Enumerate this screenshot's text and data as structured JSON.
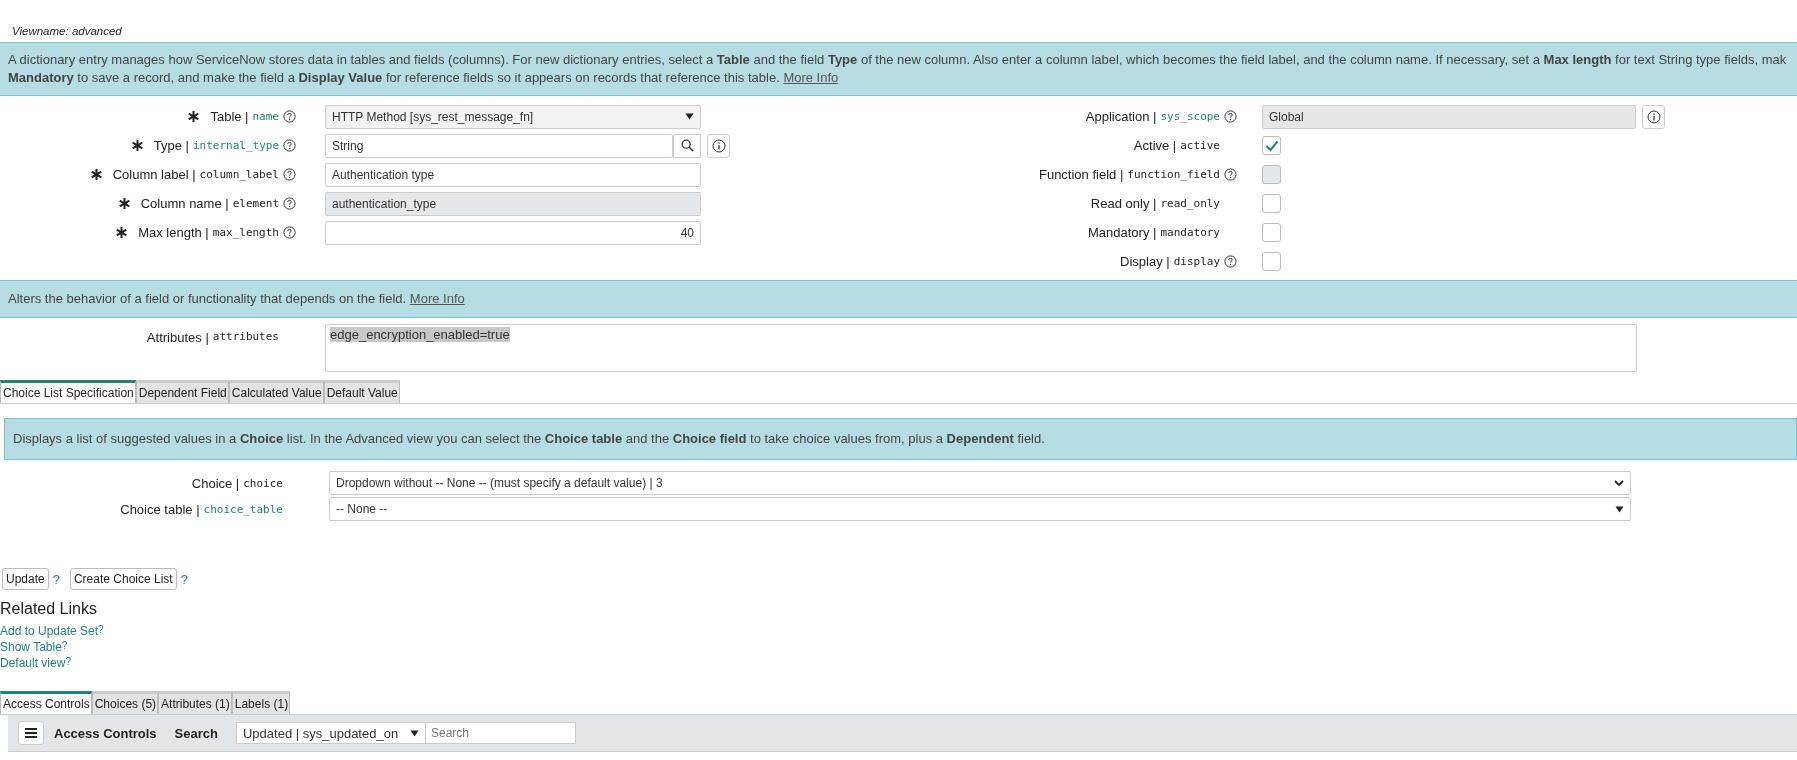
{
  "viewname": "Viewname: advanced",
  "info_banner": {
    "lines": [
      "A dictionary entry manages how ServiceNow stores data in tables and fields (columns). For new dictionary entries, select a **Table** and the field **Type** of the new column. Also enter a column label, which becomes the field label, and the column name. If necessary, set a **Max length** for text String type fields, mak",
      "**Mandatory** to save a record, and make the field a **Display Value** for reference fields so it appears on records that reference this table."
    ],
    "link": "More Info"
  },
  "left_fields": [
    {
      "label": "Table |",
      "name": "name",
      "required": true,
      "reference": true,
      "help": true,
      "kind": "select",
      "value": "HTTP Method [sys_rest_message_fn]"
    },
    {
      "label": "Type |",
      "name": "internal_type",
      "required": true,
      "reference": true,
      "help": true,
      "kind": "lookup",
      "value": "String"
    },
    {
      "label": "Column label |",
      "name": "column_label",
      "required": true,
      "reference": false,
      "help": true,
      "kind": "text",
      "value": "Authentication type"
    },
    {
      "label": "Column name |",
      "name": "element",
      "required": true,
      "reference": false,
      "help": true,
      "kind": "readonly",
      "value": "authentication_type"
    },
    {
      "label": "Max length |",
      "name": "max_length",
      "required": true,
      "reference": false,
      "help": true,
      "kind": "number",
      "value": "40"
    }
  ],
  "right_fields": [
    {
      "label": "Application |",
      "name": "sys_scope",
      "reference": true,
      "help": true,
      "kind": "readonly",
      "value": "Global"
    },
    {
      "label": "Active |",
      "name": "active",
      "reference": false,
      "help": false,
      "kind": "checkbox",
      "checked": true,
      "disabled": false
    },
    {
      "label": "Function field |",
      "name": "function_field",
      "reference": false,
      "help": true,
      "kind": "checkbox",
      "checked": false,
      "disabled": true
    },
    {
      "label": "Read only |",
      "name": "read_only",
      "reference": false,
      "help": false,
      "kind": "checkbox",
      "checked": false,
      "disabled": false
    },
    {
      "label": "Mandatory |",
      "name": "mandatory",
      "reference": false,
      "help": false,
      "kind": "checkbox",
      "checked": false,
      "disabled": false
    },
    {
      "label": "Display |",
      "name": "display",
      "reference": false,
      "help": true,
      "kind": "checkbox",
      "checked": false,
      "disabled": false
    }
  ],
  "behavior_banner": {
    "text": "Alters the behavior of a field or functionality that depends on the field.",
    "link": "More Info"
  },
  "attributes": {
    "label": "Attributes |",
    "name": "attributes",
    "value": "edge_encryption_enabled=true"
  },
  "section_tabs": [
    {
      "label": "Choice List Specification",
      "selected": true
    },
    {
      "label": "Dependent Field",
      "selected": false
    },
    {
      "label": "Calculated Value",
      "selected": false
    },
    {
      "label": "Default Value",
      "selected": false
    }
  ],
  "choice_banner": "Displays a list of suggested values in a **Choice** list. In the Advanced view you can select the **Choice table** and the **Choice field** to take choice values from, plus a **Dependent** field.",
  "choice_fields": [
    {
      "label": "Choice |",
      "name": "choice",
      "reference": false,
      "kind": "native",
      "value": "Dropdown without -- None -- (must specify a default value) | 3"
    },
    {
      "label": "Choice table |",
      "name": "choice_table",
      "reference": true,
      "kind": "select",
      "value": "-- None --"
    }
  ],
  "buttons": [
    {
      "label": "Update",
      "help": "?"
    },
    {
      "label": "Create Choice List",
      "help": "?"
    }
  ],
  "related_links": {
    "title": "Related Links",
    "links": [
      {
        "label": "Add to Update Set",
        "help": "?"
      },
      {
        "label": "Show Table",
        "help": "?"
      },
      {
        "label": "Default view",
        "help": "?"
      }
    ]
  },
  "list_tabs": [
    {
      "label": "Access Controls",
      "selected": true
    },
    {
      "label": "Choices (5)",
      "selected": false
    },
    {
      "label": "Attributes (1)",
      "selected": false
    },
    {
      "label": "Labels (1)",
      "selected": false
    }
  ],
  "list_toolbar": {
    "title": "Access Controls",
    "search_label": "Search",
    "search_field": "Updated | sys_updated_on",
    "placeholder": "Search"
  }
}
